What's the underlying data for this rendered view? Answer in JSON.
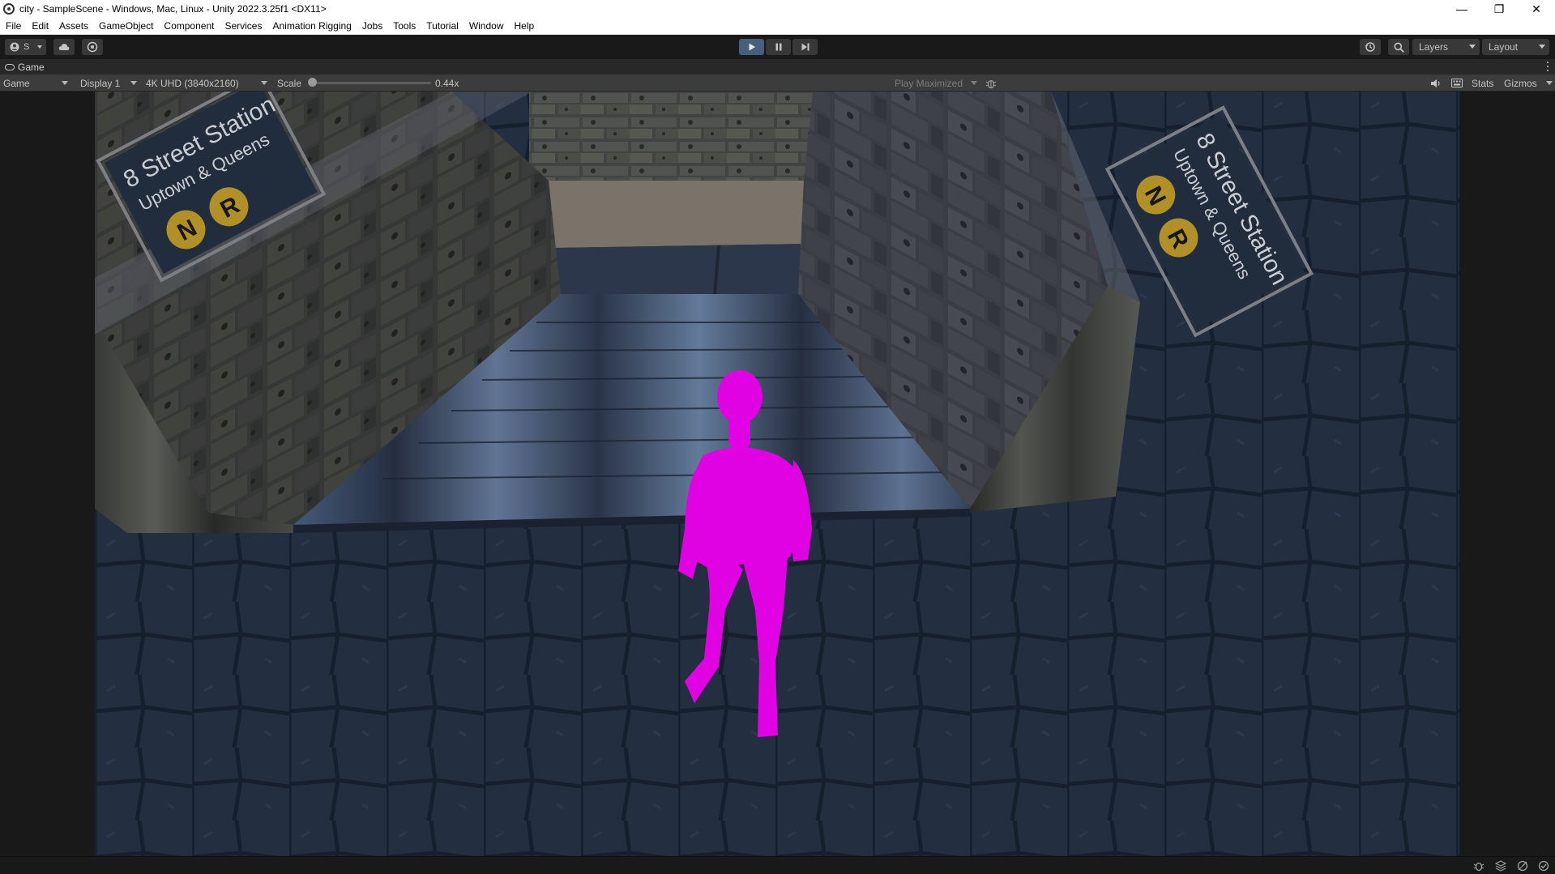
{
  "window": {
    "title": "city - SampleScene - Windows, Mac, Linux - Unity 2022.3.25f1 <DX11>",
    "minimize": "—",
    "maximize": "❐",
    "close": "✕"
  },
  "menubar": {
    "items": [
      "File",
      "Edit",
      "Assets",
      "GameObject",
      "Component",
      "Services",
      "Animation Rigging",
      "Jobs",
      "Tools",
      "Tutorial",
      "Window",
      "Help"
    ]
  },
  "toolbar": {
    "account_label": "S",
    "layers_label": "Layers",
    "layout_label": "Layout",
    "play_active": true,
    "accent_color": "#46607c"
  },
  "game_tab": {
    "label": "Game"
  },
  "game_toolbar": {
    "view_mode": "Game",
    "display": "Display 1",
    "resolution": "4K UHD (3840x2160)",
    "scale_label": "Scale",
    "scale_value": "0.44x",
    "play_mode": "Play Maximized",
    "stats_label": "Stats",
    "gizmos_label": "Gizmos"
  },
  "scene": {
    "left_sign": {
      "line1": "8 Street Station",
      "line2": "Uptown & Queens",
      "badge1": "N",
      "badge2": "R",
      "badge_color": "#c9a22a"
    },
    "right_sign": {
      "line1": "8 Street Station",
      "line2": "Uptown & Queens",
      "badge1": "N",
      "badge2": "R",
      "badge_color": "#c9a22a"
    },
    "character_color": "#ff00ff"
  }
}
